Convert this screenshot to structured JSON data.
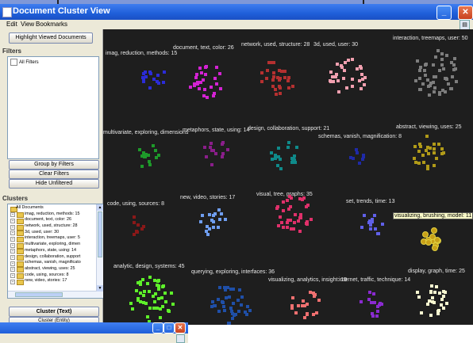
{
  "window": {
    "title": "Document Cluster View"
  },
  "menu": [
    "Edit",
    "View",
    "Bookmarks"
  ],
  "left": {
    "highlight_button": "Highlight Viewed Documents",
    "filters_title": "Filters",
    "filters": [
      "All Filters"
    ],
    "group_button": "Group by Filters",
    "clear_button": "Clear Filters",
    "hide_button": "Hide Unfiltered",
    "clusters_title": "Clusters",
    "tree_root": "All Documents",
    "tree_items": [
      "imag, reduction, methods: 15",
      "document, text, color: 26",
      "network, used, structure: 28",
      "3d, used, user: 30",
      "interaction, treemaps, user: 5",
      "multivariate, exploring, dimen",
      "metaphors, state, using: 14",
      "design, collaboration, support",
      "schemas, vanish, magnificato",
      "abstract, viewing, uses: 25",
      "code, using, sources: 8",
      "new, video, stories: 17"
    ],
    "cluster_text_button": "Cluster (Text)",
    "cluster_entity_button": "Cluster (Entity)"
  },
  "clusters": [
    {
      "label": "imag, reduction, methods: 15",
      "color": "#2b2bd8",
      "n": 15
    },
    {
      "label": "document, text, color: 26",
      "color": "#d322d3",
      "n": 26
    },
    {
      "label": "network, used, structure: 28",
      "color": "#b53030",
      "n": 28
    },
    {
      "label": "3d, used, user: 30",
      "color": "#f2a0b0",
      "n": 30
    },
    {
      "label": "interaction, treemaps, user: 50",
      "color": "#7d7d7d",
      "n": 50
    },
    {
      "label": "multivariate, exploring, dimensions",
      "color": "#1e9a2a",
      "n": 15
    },
    {
      "label": "metaphors, state, using: 14",
      "color": "#8a1e8a",
      "n": 14
    },
    {
      "label": "design, collaboration, support: 21",
      "color": "#0f8a8a",
      "n": 21
    },
    {
      "label": "schemas, vanish, magnification: 8",
      "color": "#1f2aa8",
      "n": 8
    },
    {
      "label": "abstract, viewing, uses: 25",
      "color": "#b09a18",
      "n": 25
    },
    {
      "label": "code, using, sources: 8",
      "color": "#8a1818",
      "n": 8
    },
    {
      "label": "new, video, stories: 17",
      "color": "#6f9ef0",
      "n": 17
    },
    {
      "label": "visual, tree, graphs: 35",
      "color": "#e0306a",
      "n": 35
    },
    {
      "label": "set, trends, time: 13",
      "color": "#6060e8",
      "n": 13
    },
    {
      "label": "visualizing, brushing, model: 11",
      "color": "#c8a018",
      "n": 11,
      "highlight": true
    },
    {
      "label": "analytic, design, systems: 45",
      "color": "#5ef02a",
      "n": 45
    },
    {
      "label": "querying, exploring, interfaces: 36",
      "color": "#1f4fa8",
      "n": 36
    },
    {
      "label": "visualizing, analytics, insight: 19",
      "color": "#f07070",
      "n": 19
    },
    {
      "label": "internet, traffic, technique: 14",
      "color": "#8a2ad0",
      "n": 14
    },
    {
      "label": "display, graph, time: 25",
      "color": "#f7f7d0",
      "n": 25
    }
  ]
}
